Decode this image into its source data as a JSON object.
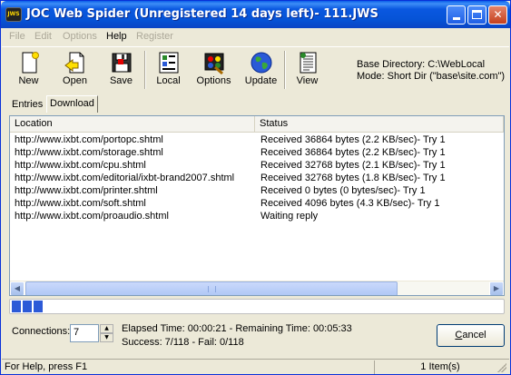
{
  "window": {
    "app_icon_text": "JWS",
    "title": "JOC Web Spider (Unregistered 14 days left)- 111.JWS"
  },
  "menu": [
    {
      "label": "File",
      "enabled": false
    },
    {
      "label": "Edit",
      "enabled": false
    },
    {
      "label": "Options",
      "enabled": false
    },
    {
      "label": "Help",
      "enabled": true
    },
    {
      "label": "Register",
      "enabled": false
    }
  ],
  "toolbar": {
    "new": "New",
    "open": "Open",
    "save": "Save",
    "local": "Local",
    "options": "Options",
    "update": "Update",
    "view": "View"
  },
  "base_info": {
    "directory": "Base Directory: C:\\WebLocal",
    "mode": "Mode: Short Dir (\"base\\site.com\")"
  },
  "tabs": {
    "entries": "Entries",
    "download": "Download"
  },
  "list": {
    "columns": {
      "location": "Location",
      "status": "Status"
    },
    "rows": [
      {
        "location": "http://www.ixbt.com/portopc.shtml",
        "status": "Received 36864 bytes (2.2 KB/sec)- Try 1"
      },
      {
        "location": "http://www.ixbt.com/storage.shtml",
        "status": "Received 36864 bytes (2.2 KB/sec)- Try 1"
      },
      {
        "location": "http://www.ixbt.com/cpu.shtml",
        "status": "Received 32768 bytes (2.1 KB/sec)- Try 1"
      },
      {
        "location": "http://www.ixbt.com/editorial/ixbt-brand2007.shtml",
        "status": "Received 32768 bytes (1.8 KB/sec)- Try 1"
      },
      {
        "location": "http://www.ixbt.com/printer.shtml",
        "status": "Received 0 bytes (0 bytes/sec)- Try 1"
      },
      {
        "location": "http://www.ixbt.com/soft.shtml",
        "status": "Received 4096 bytes (4.3 KB/sec)- Try 1"
      },
      {
        "location": "http://www.ixbt.com/proaudio.shtml",
        "status": "Waiting reply"
      }
    ]
  },
  "progress": {
    "blocks_filled": 3
  },
  "connections": {
    "label": "Connections:",
    "value": "7"
  },
  "stats": {
    "time": "Elapsed Time: 00:00:21 - Remaining Time: 00:05:33",
    "result": "Success: 7/118 - Fail: 0/118"
  },
  "cancel": {
    "accel": "C",
    "rest": "ancel"
  },
  "statusbar": {
    "help": "For Help, press F1",
    "items": "1 Item(s)"
  },
  "colors": {
    "title_bar": "#0a58e0",
    "progress": "#2c5ad7",
    "close_button": "#c5401d"
  }
}
